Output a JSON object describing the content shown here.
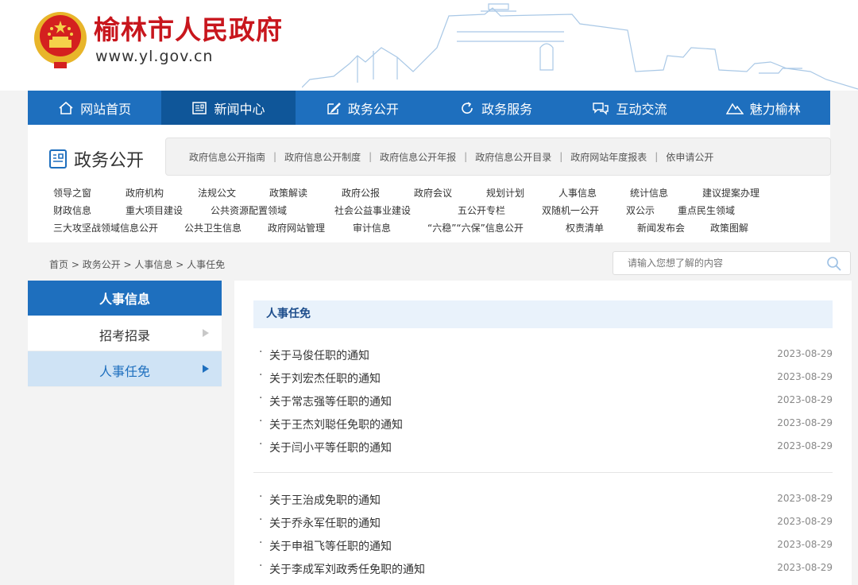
{
  "header": {
    "title": "榆林市人民政府",
    "url": "www.yl.gov.cn"
  },
  "nav": [
    {
      "label": "网站首页",
      "icon": "home-icon"
    },
    {
      "label": "新闻中心",
      "icon": "newspaper-icon",
      "active": true
    },
    {
      "label": "政务公开",
      "icon": "edit-icon"
    },
    {
      "label": "政务服务",
      "icon": "refresh-icon"
    },
    {
      "label": "互动交流",
      "icon": "chat-icon"
    },
    {
      "label": "魅力榆林",
      "icon": "mountain-icon"
    }
  ],
  "section": {
    "title": "政务公开",
    "links": [
      "政府信息公开指南",
      "政府信息公开制度",
      "政府信息公开年报",
      "政府信息公开目录",
      "政府网站年度报表",
      "依申请公开"
    ]
  },
  "categories": [
    [
      "领导之窗",
      "政府机构",
      "法规公文",
      "政策解读",
      "政府公报",
      "政府会议",
      "规划计划",
      "人事信息",
      "统计信息",
      "建议提案办理"
    ],
    [
      "财政信息",
      "重大项目建设",
      "公共资源配置领域",
      "社会公益事业建设",
      "五公开专栏",
      "双随机一公开",
      "双公示",
      "重点民生领域"
    ],
    [
      "三大攻坚战领域信息公开",
      "公共卫生信息",
      "政府网站管理",
      "审计信息",
      "“六稳”“六保”信息公开",
      "权责清单",
      "新闻发布会",
      "政策图解"
    ]
  ],
  "breadcrumb": [
    "首页",
    "政务公开",
    "人事信息",
    "人事任免"
  ],
  "search": {
    "placeholder": "请输入您想了解的内容"
  },
  "sidebar": {
    "title": "人事信息",
    "items": [
      {
        "label": "招考招录",
        "active": false
      },
      {
        "label": "人事任免",
        "active": true
      }
    ]
  },
  "main": {
    "title": "人事任免",
    "group1": [
      {
        "title": "关于马俊任职的通知",
        "date": "2023-08-29"
      },
      {
        "title": "关于刘宏杰任职的通知",
        "date": "2023-08-29"
      },
      {
        "title": "关于常志强等任职的通知",
        "date": "2023-08-29"
      },
      {
        "title": "关于王杰刘聪任免职的通知",
        "date": "2023-08-29"
      },
      {
        "title": "关于闫小平等任职的通知",
        "date": "2023-08-29"
      }
    ],
    "group2": [
      {
        "title": "关于王治成免职的通知",
        "date": "2023-08-29"
      },
      {
        "title": "关于乔永军任职的通知",
        "date": "2023-08-29"
      },
      {
        "title": "关于申祖飞等任职的通知",
        "date": "2023-08-29"
      },
      {
        "title": "关于李成军刘政秀任免职的通知",
        "date": "2023-08-29"
      }
    ]
  },
  "colors": {
    "brand_red": "#c8161d",
    "nav_blue": "#1e6fbe",
    "nav_active": "#0f5699",
    "highlight": "#cfe3f5"
  }
}
